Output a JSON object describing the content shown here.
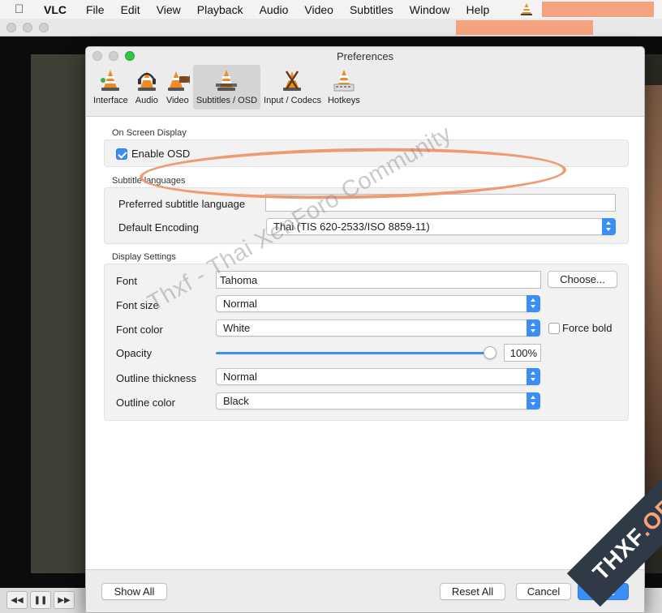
{
  "menubar": {
    "app": "VLC",
    "items": [
      "File",
      "Edit",
      "View",
      "Playback",
      "Audio",
      "Video",
      "Subtitles",
      "Window",
      "Help"
    ]
  },
  "dialog": {
    "title": "Preferences",
    "tabs": [
      {
        "label": "Interface",
        "icon": "cone-interface-icon"
      },
      {
        "label": "Audio",
        "icon": "cone-headphones-icon"
      },
      {
        "label": "Video",
        "icon": "cone-video-icon"
      },
      {
        "label": "Subtitles / OSD",
        "icon": "cone-subtitles-icon",
        "selected": true
      },
      {
        "label": "Input / Codecs",
        "icon": "cone-codecs-icon"
      },
      {
        "label": "Hotkeys",
        "icon": "cone-hotkeys-icon"
      }
    ]
  },
  "osd": {
    "section": "On Screen Display",
    "enable_label": "Enable OSD",
    "enable_checked": true
  },
  "subtitle_languages": {
    "section": "Subtitle languages",
    "preferred_label": "Preferred subtitle language",
    "preferred_value": "",
    "encoding_label": "Default Encoding",
    "encoding_value": "Thai (TIS 620-2533/ISO 8859-11)"
  },
  "display": {
    "section": "Display Settings",
    "font_label": "Font",
    "font_value": "Tahoma",
    "choose_label": "Choose...",
    "font_size_label": "Font size",
    "font_size_value": "Normal",
    "font_color_label": "Font color",
    "font_color_value": "White",
    "force_bold_label": "Force bold",
    "force_bold_checked": false,
    "opacity_label": "Opacity",
    "opacity_value": "100%",
    "opacity_level": 1.0,
    "outline_thickness_label": "Outline thickness",
    "outline_thickness_value": "Normal",
    "outline_color_label": "Outline color",
    "outline_color_value": "Black"
  },
  "footer": {
    "show_all": "Show All",
    "reset_all": "Reset All",
    "cancel": "Cancel",
    "save": "Save"
  },
  "player_controls": {
    "rewind": "◀◀",
    "pause": "❚❚",
    "forward": "▶▶"
  },
  "overlay": {
    "watermark": "Thxf - Thai XenForo Community",
    "logo_main": "THXF",
    "logo_suffix": ".ORG"
  },
  "colors": {
    "accent": "#3a8ef6",
    "annotation": "#ef9a70",
    "redaction": "#f4a37e"
  }
}
